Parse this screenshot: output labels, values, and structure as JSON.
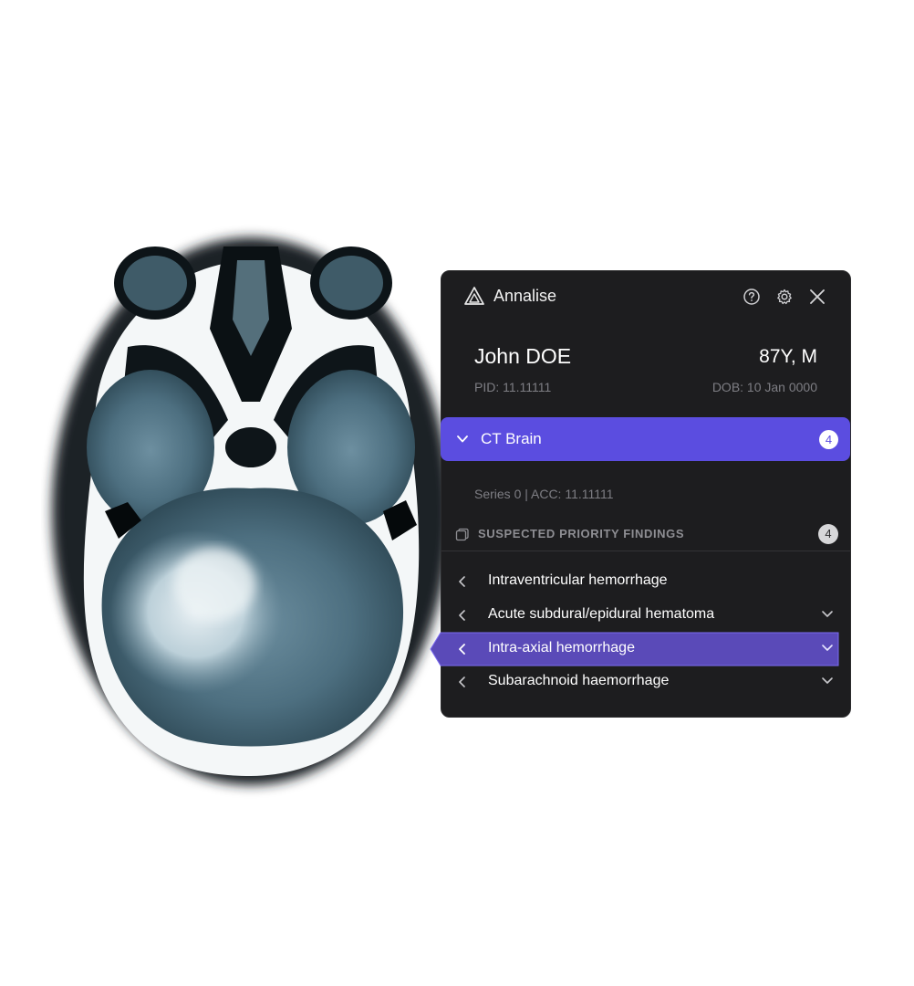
{
  "header": {
    "brand": "Annalise",
    "icons": [
      "logo-triangle-icon",
      "help-icon",
      "gear-icon",
      "close-icon"
    ]
  },
  "patient": {
    "name": "John DOE",
    "age_sex": "87Y, M",
    "pid": "PID: 11.11111",
    "dob": "DOB: 10 Jan 0000"
  },
  "study": {
    "label": "CT Brain",
    "count": "4",
    "series": "Series 0 | ACC: 11.11111"
  },
  "findings_section": {
    "label": "SUSPECTED PRIORITY FINDINGS",
    "count": "4",
    "items": [
      {
        "label": "Intraventricular hemorrhage",
        "active": false,
        "expandable": false
      },
      {
        "label": "Acute subdural/epidural hematoma",
        "active": false,
        "expandable": true
      },
      {
        "label": "Intra-axial hemorrhage",
        "active": true,
        "expandable": true
      },
      {
        "label": "Subarachnoid haemorrhage",
        "active": false,
        "expandable": true
      }
    ]
  },
  "colors": {
    "panel_bg": "#1d1d1f",
    "accent": "#5b4de0",
    "active_row": "#5a4ab8",
    "muted_text": "#7e7e84"
  }
}
